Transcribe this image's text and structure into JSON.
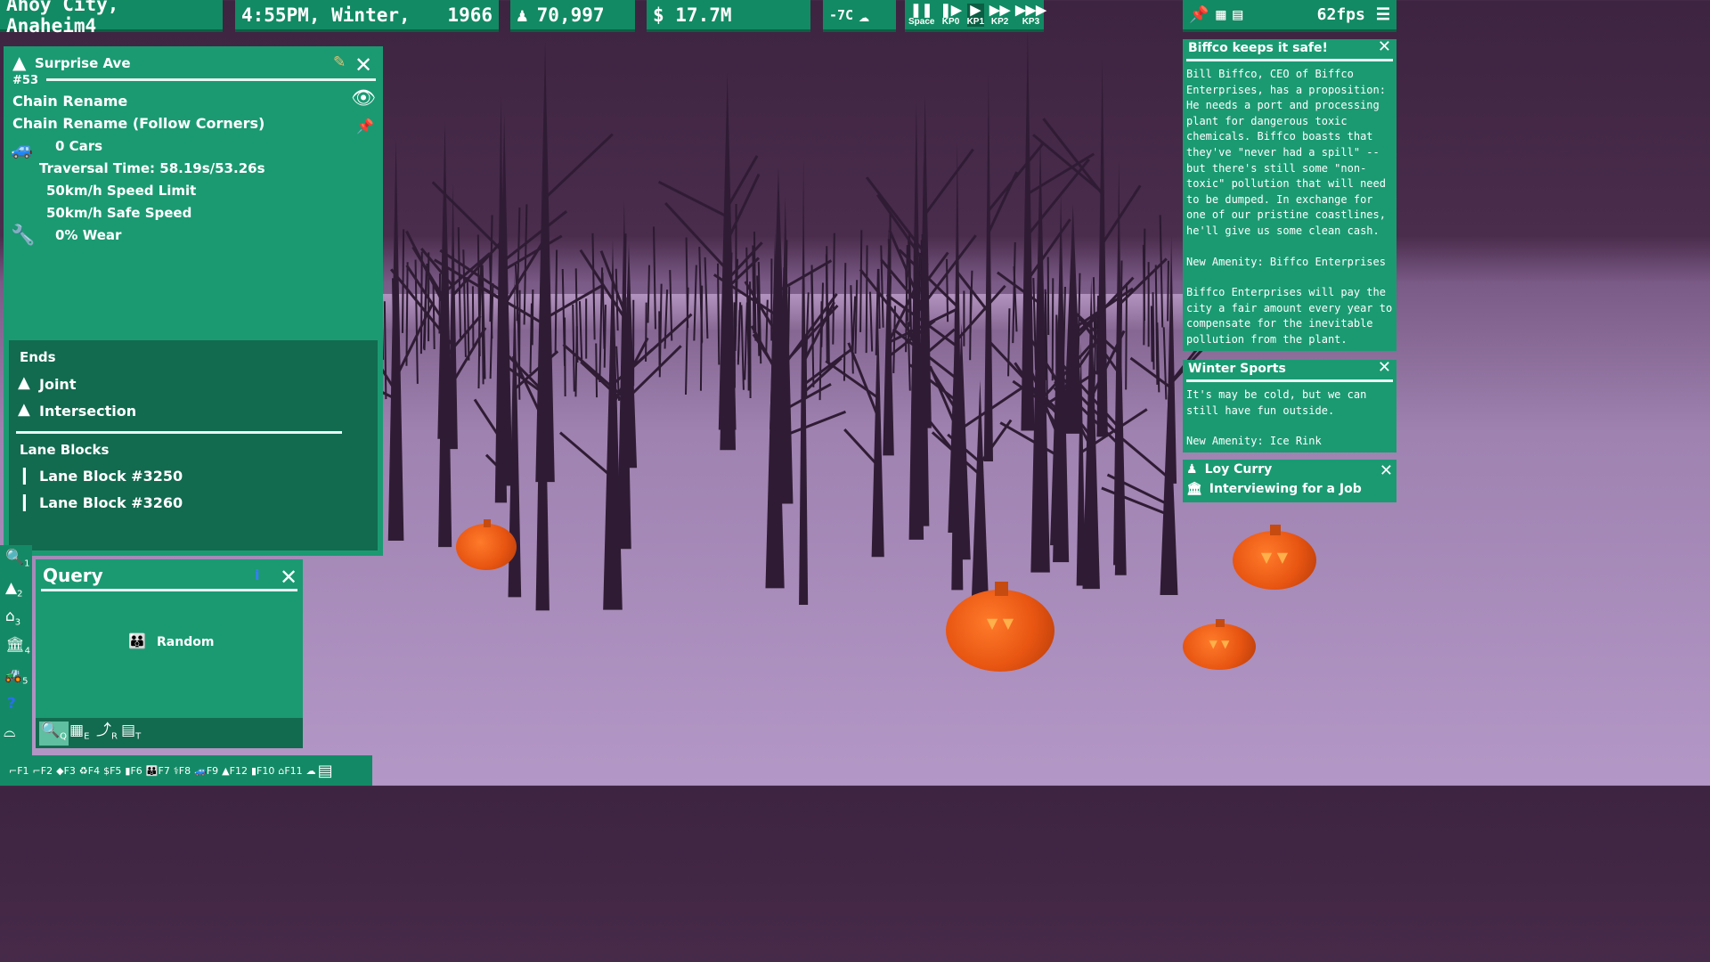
{
  "topbar": {
    "city": "Ahoy City, Anaheim4",
    "datetime": "4:55PM, Winter,",
    "year": "1966",
    "population": "70,997",
    "money": "$ 17.7M",
    "temperature": "-7C",
    "speeds": [
      {
        "key": "Space",
        "icon": "pause-icon"
      },
      {
        "key": "KP0",
        "icon": "step-icon"
      },
      {
        "key": "KP1",
        "icon": "play-icon"
      },
      {
        "key": "KP2",
        "icon": "fast-icon"
      },
      {
        "key": "KP3",
        "icon": "fastest-icon"
      }
    ],
    "fps": "62fps"
  },
  "road_panel": {
    "number": "#53",
    "name": "Surprise Ave",
    "actions": [
      "Chain Rename",
      "Chain Rename (Follow Corners)"
    ],
    "cars": "0 Cars",
    "traversal": "Traversal Time: 58.19s/53.26s",
    "speed_limit": "50km/h Speed Limit",
    "safe_speed": "50km/h Safe Speed",
    "wear": "0% Wear",
    "ends_title": "Ends",
    "ends": [
      "Joint",
      "Intersection"
    ],
    "lane_blocks_title": "Lane Blocks",
    "lane_blocks": [
      "Lane Block #3250",
      "Lane Block #3260"
    ]
  },
  "query_panel": {
    "title": "Query",
    "mode": "Random",
    "tabs": [
      {
        "icon": "magnifier-icon",
        "key": "Q"
      },
      {
        "icon": "grid-icon",
        "key": "E"
      },
      {
        "icon": "route-icon",
        "key": "R"
      },
      {
        "icon": "text-icon",
        "key": "T"
      }
    ]
  },
  "left_toolbar": [
    {
      "icon": "magnifier-icon",
      "key": "1"
    },
    {
      "icon": "road-icon",
      "key": "2"
    },
    {
      "icon": "house-icon",
      "key": "3"
    },
    {
      "icon": "building-icon",
      "key": "4"
    },
    {
      "icon": "bulldozer-icon",
      "key": "5"
    },
    {
      "icon": "help-icon",
      "key": ""
    },
    {
      "icon": "bridge-icon",
      "key": ""
    }
  ],
  "bottom_toolbar": [
    "F1",
    "F2",
    "F3",
    "F4",
    "F5",
    "F6",
    "F7",
    "F8",
    "F9",
    "F12",
    "F10",
    "F11"
  ],
  "news": [
    {
      "title": "Biffco keeps it safe!",
      "paragraphs": [
        "Bill Biffco, CEO of Biffco Enterprises, has a proposition: He needs a port and processing plant for dangerous toxic chemicals. Biffco boasts that they've \"never had a spill\" -- but there's still some \"non-toxic\" pollution that will need to be dumped. In exchange for one of our pristine coastlines, he'll give us some clean cash.",
        "New Amenity: Biffco Enterprises",
        "Biffco Enterprises will pay the city a fair amount every year to compensate for the inevitable pollution from the plant."
      ]
    },
    {
      "title": "Winter Sports",
      "paragraphs": [
        "It's may be cold, but we can still have fun outside.",
        "New Amenity: Ice Rink"
      ]
    }
  ],
  "person_notice": {
    "name": "Loy Curry",
    "status": "Interviewing for a Job"
  },
  "colors": {
    "panel": "#1b9a72",
    "panel_dark": "#126a4f",
    "sky": "#3d2440",
    "snow": "#b397c6",
    "pumpkin": "#e85512"
  }
}
